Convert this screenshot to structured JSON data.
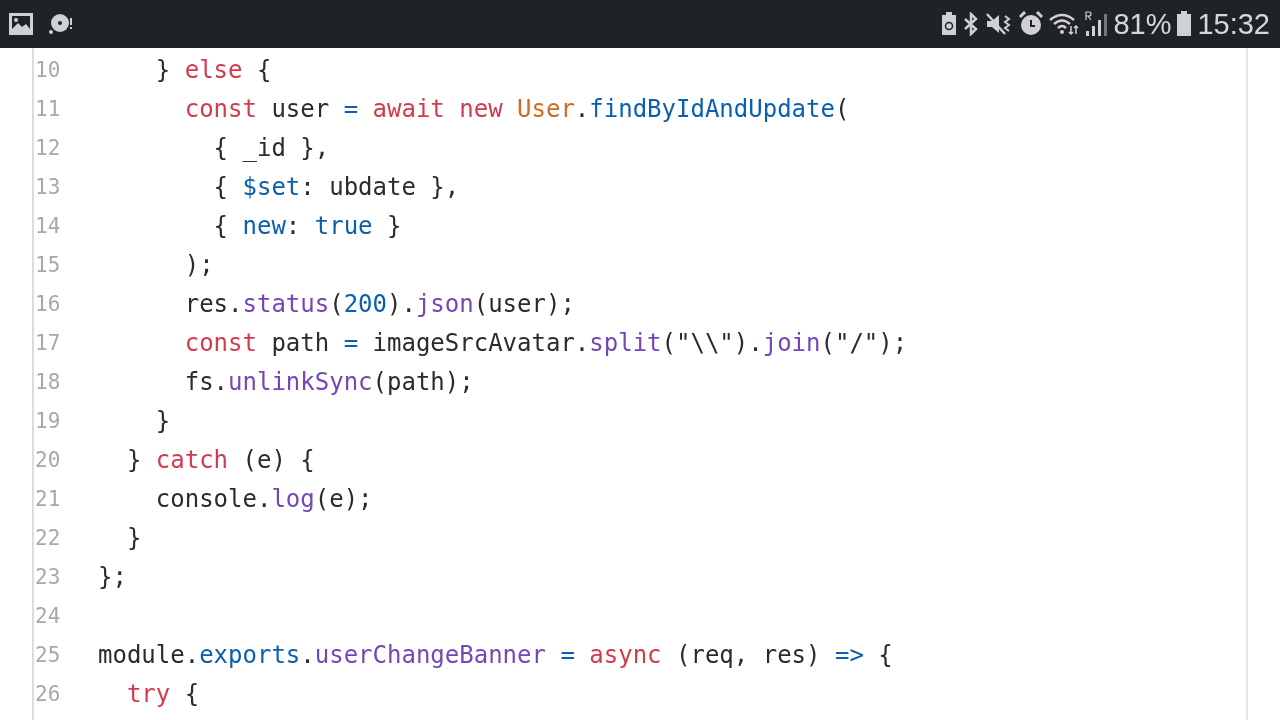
{
  "status_bar": {
    "battery_level_text": "81%",
    "time": "15:32"
  },
  "code_lines": [
    {
      "number": "10",
      "tokens": [
        {
          "text": "    } ",
          "kind": "plain"
        },
        {
          "text": "else",
          "kind": "keyword"
        },
        {
          "text": " {",
          "kind": "plain"
        }
      ]
    },
    {
      "number": "11",
      "tokens": [
        {
          "text": "      const",
          "kind": "keyword"
        },
        {
          "text": " user ",
          "kind": "plain"
        },
        {
          "text": "=",
          "kind": "operator"
        },
        {
          "text": " await",
          "kind": "keyword"
        },
        {
          "text": " new",
          "kind": "keyword"
        },
        {
          "text": " User",
          "kind": "class"
        },
        {
          "text": ".",
          "kind": "plain"
        },
        {
          "text": "findByIdAndUpdate",
          "kind": "operator"
        },
        {
          "text": "(",
          "kind": "plain"
        }
      ]
    },
    {
      "number": "12",
      "tokens": [
        {
          "text": "        { _id },",
          "kind": "plain"
        }
      ]
    },
    {
      "number": "13",
      "tokens": [
        {
          "text": "        { ",
          "kind": "plain"
        },
        {
          "text": "$set",
          "kind": "operator"
        },
        {
          "text": ": ubdate },",
          "kind": "plain"
        }
      ]
    },
    {
      "number": "14",
      "tokens": [
        {
          "text": "        { ",
          "kind": "plain"
        },
        {
          "text": "new",
          "kind": "operator"
        },
        {
          "text": ": ",
          "kind": "plain"
        },
        {
          "text": "true",
          "kind": "operator"
        },
        {
          "text": " }",
          "kind": "plain"
        }
      ]
    },
    {
      "number": "15",
      "tokens": [
        {
          "text": "      );",
          "kind": "plain"
        }
      ]
    },
    {
      "number": "16",
      "tokens": [
        {
          "text": "      res.",
          "kind": "plain"
        },
        {
          "text": "status",
          "kind": "function"
        },
        {
          "text": "(",
          "kind": "plain"
        },
        {
          "text": "200",
          "kind": "operator"
        },
        {
          "text": ").",
          "kind": "plain"
        },
        {
          "text": "json",
          "kind": "function"
        },
        {
          "text": "(user);",
          "kind": "plain"
        }
      ]
    },
    {
      "number": "17",
      "tokens": [
        {
          "text": "      const",
          "kind": "keyword"
        },
        {
          "text": " path ",
          "kind": "plain"
        },
        {
          "text": "=",
          "kind": "operator"
        },
        {
          "text": " imageSrcAvatar.",
          "kind": "plain"
        },
        {
          "text": "split",
          "kind": "function"
        },
        {
          "text": "(\"\\\\\").",
          "kind": "plain"
        },
        {
          "text": "join",
          "kind": "function"
        },
        {
          "text": "(\"/\");",
          "kind": "plain"
        }
      ]
    },
    {
      "number": "18",
      "tokens": [
        {
          "text": "      fs.",
          "kind": "plain"
        },
        {
          "text": "unlinkSync",
          "kind": "function"
        },
        {
          "text": "(path);",
          "kind": "plain"
        }
      ]
    },
    {
      "number": "19",
      "tokens": [
        {
          "text": "    }",
          "kind": "plain"
        }
      ]
    },
    {
      "number": "20",
      "tokens": [
        {
          "text": "  } ",
          "kind": "plain"
        },
        {
          "text": "catch",
          "kind": "keyword"
        },
        {
          "text": " (e) {",
          "kind": "plain"
        }
      ]
    },
    {
      "number": "21",
      "tokens": [
        {
          "text": "    console.",
          "kind": "plain"
        },
        {
          "text": "log",
          "kind": "function"
        },
        {
          "text": "(e);",
          "kind": "plain"
        }
      ]
    },
    {
      "number": "22",
      "tokens": [
        {
          "text": "  }",
          "kind": "plain"
        }
      ]
    },
    {
      "number": "23",
      "tokens": [
        {
          "text": "};",
          "kind": "plain"
        }
      ]
    },
    {
      "number": "24"
    },
    {
      "number": "25",
      "tokens": [
        {
          "text": "module.",
          "kind": "plain"
        },
        {
          "text": "exports",
          "kind": "operator"
        },
        {
          "text": ".",
          "kind": "plain"
        },
        {
          "text": "userChangeBanner",
          "kind": "function"
        },
        {
          "text": " =",
          "kind": "operator"
        },
        {
          "text": " async",
          "kind": "keyword"
        },
        {
          "text": " (req, res) ",
          "kind": "plain"
        },
        {
          "text": "=>",
          "kind": "operator"
        },
        {
          "text": " {",
          "kind": "plain"
        }
      ]
    },
    {
      "number": "26",
      "tokens": [
        {
          "text": "  try",
          "kind": "keyword"
        },
        {
          "text": " {",
          "kind": "plain"
        }
      ]
    }
  ]
}
